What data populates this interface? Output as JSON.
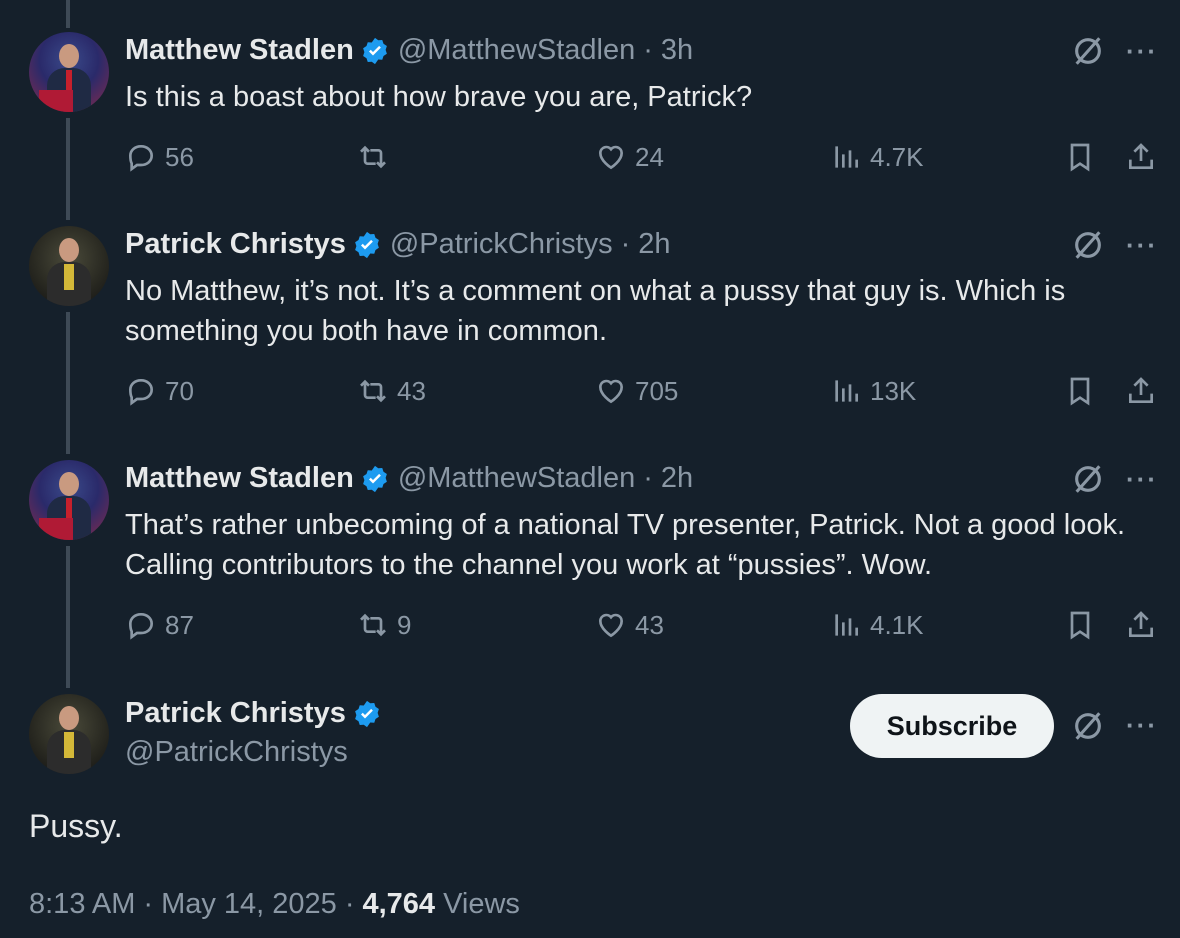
{
  "replies": [
    {
      "name": "Matthew Stadlen",
      "handle": "@MatthewStadlen",
      "time": "3h",
      "text": "Is this a boast about how brave you are, Patrick?",
      "replies": "56",
      "retweets": "",
      "likes": "24",
      "views": "4.7K"
    },
    {
      "name": "Patrick Christys",
      "handle": "@PatrickChristys",
      "time": "2h",
      "text": "No Matthew, it’s not. It’s a comment on what a pussy that guy is. Which is something you both have in common.",
      "replies": "70",
      "retweets": "43",
      "likes": "705",
      "views": "13K"
    },
    {
      "name": "Matthew Stadlen",
      "handle": "@MatthewStadlen",
      "time": "2h",
      "text": "That’s rather unbecoming of a national TV presenter, Patrick. Not a good look. Calling contributors to the channel you work at “pussies”. Wow.",
      "replies": "87",
      "retweets": "9",
      "likes": "43",
      "views": "4.1K"
    }
  ],
  "main": {
    "name": "Patrick Christys",
    "handle": "@PatrickChristys",
    "subscribe_label": "Subscribe",
    "text": "Pussy.",
    "time": "8:13 AM",
    "date": "May 14, 2025",
    "views_count": "4,764",
    "views_label": "Views",
    "dot": "·"
  },
  "icons": {
    "verified": "verified-badge-icon",
    "grok": "grok-icon",
    "more": "more-icon",
    "reply": "reply-icon",
    "retweet": "retweet-icon",
    "like": "like-icon",
    "views": "views-icon",
    "bookmark": "bookmark-icon",
    "share": "share-icon"
  },
  "colors": {
    "background": "#15202b",
    "text": "#e7e9ea",
    "muted": "#8b98a5",
    "verified": "#1d9bf0"
  }
}
